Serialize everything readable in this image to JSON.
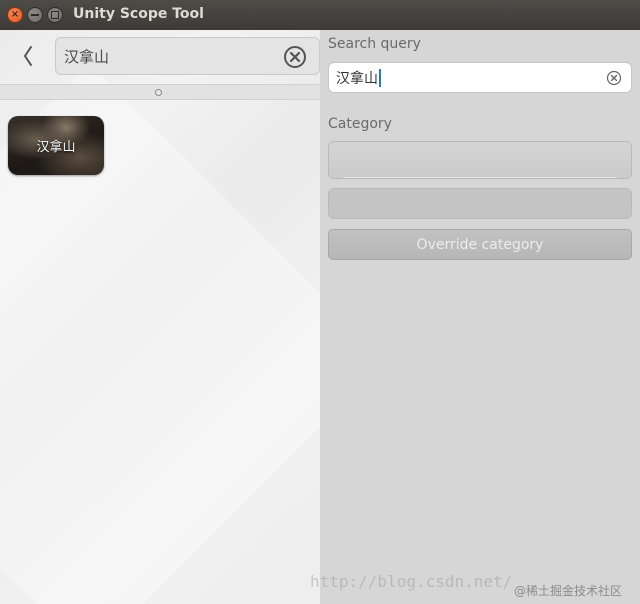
{
  "window": {
    "title": "Unity Scope Tool"
  },
  "left": {
    "search_value": "汉拿山",
    "results": [
      {
        "label": "汉拿山"
      }
    ]
  },
  "right": {
    "search_query_label": "Search query",
    "search_query_value": "汉拿山",
    "category_label": "Category",
    "override_button_label": "Override category"
  },
  "watermark": {
    "url": "http://blog.csdn.net/",
    "site": "@稀土掘金技术社区"
  },
  "colors": {
    "titlebar": "#3c3b37",
    "close_button": "#e2561c",
    "caret": "#2a7ab0"
  }
}
